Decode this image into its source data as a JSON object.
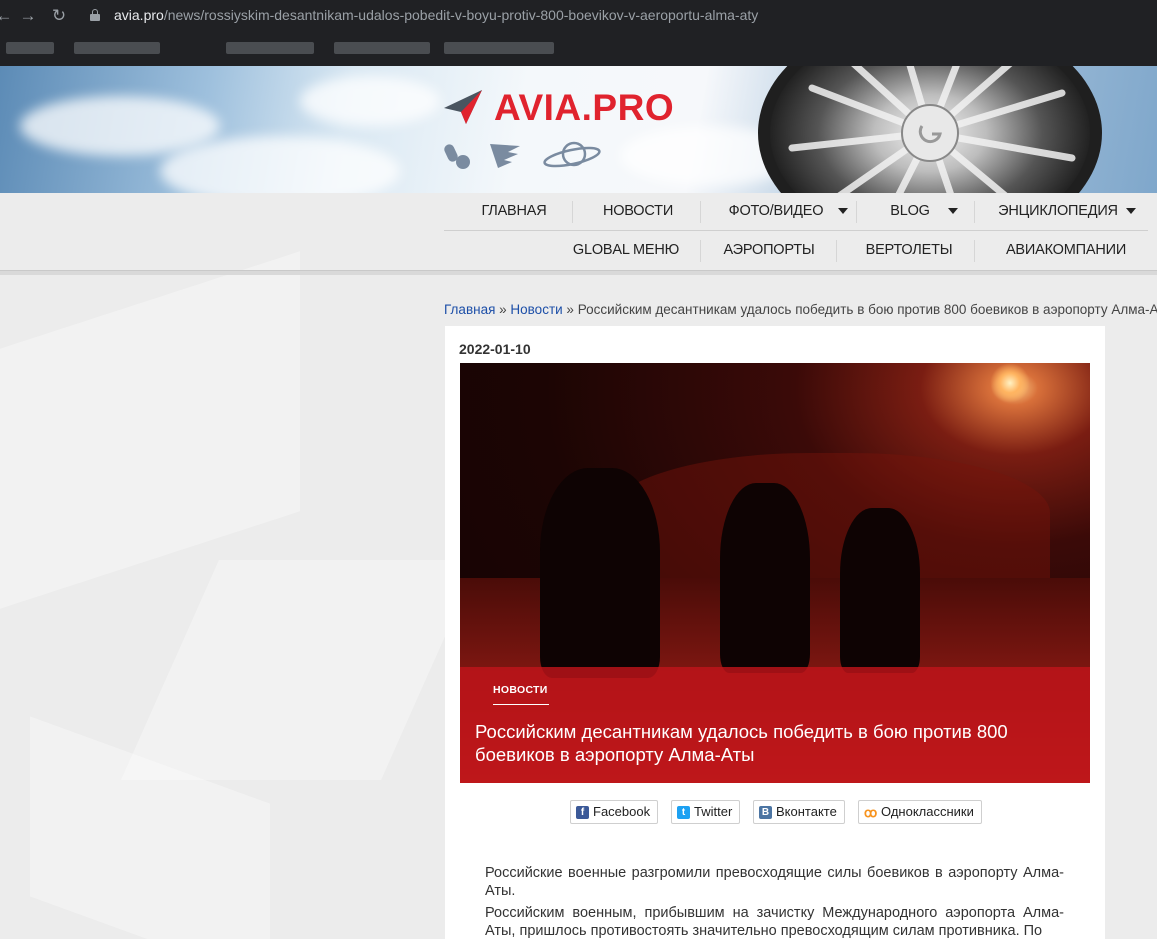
{
  "browser": {
    "url_host": "avia.pro",
    "url_path": "/news/rossiyskim-desantnikam-udalos-pobedit-v-boyu-protiv-800-boevikov-v-aeroportu-alma-aty"
  },
  "site": {
    "logo_text": "AVIA.PRO",
    "brand_color": "#e0232e"
  },
  "nav": {
    "row1": [
      {
        "label": "ГЛАВНАЯ",
        "has_dropdown": false
      },
      {
        "label": "НОВОСТИ",
        "has_dropdown": false
      },
      {
        "label": "ФОТО/ВИДЕО",
        "has_dropdown": true
      },
      {
        "label": "BLOG",
        "has_dropdown": true
      },
      {
        "label": "ЭНЦИКЛОПЕДИЯ",
        "has_dropdown": true
      }
    ],
    "row2": [
      {
        "label": "GLOBAL МЕНЮ"
      },
      {
        "label": "АЭРОПОРТЫ"
      },
      {
        "label": "ВЕРТОЛЕТЫ"
      },
      {
        "label": "АВИАКОМПАНИИ"
      }
    ]
  },
  "breadcrumb": {
    "home": "Главная",
    "sep": " » ",
    "news": "Новости",
    "current": "Российским десантникам удалось победить в бою против 800 боевиков в аэропорту Алма-Аты"
  },
  "article": {
    "date": "2022-01-10",
    "category": "НОВОСТИ",
    "title": "Российским десантникам удалось победить в бою против 800 боевиков в аэропорту Алма-Аты",
    "share": [
      {
        "label": "Facebook",
        "icon": "facebook-icon",
        "color": "#3b5998"
      },
      {
        "label": "Twitter",
        "icon": "twitter-icon",
        "color": "#1da1f2"
      },
      {
        "label": "Вконтакте",
        "icon": "vk-icon",
        "color": "#4c75a3"
      },
      {
        "label": "Одноклассники",
        "icon": "odnoklassniki-icon",
        "color": "#f7931e"
      }
    ],
    "paragraphs": [
      "Российские военные разгромили превосходящие силы боевиков в аэропорту Алма-Аты.",
      "Российским военным, прибывшим на зачистку Международного аэропорта Алма-Аты, пришлось противостоять значительно превосходящим силам противника. По"
    ]
  }
}
